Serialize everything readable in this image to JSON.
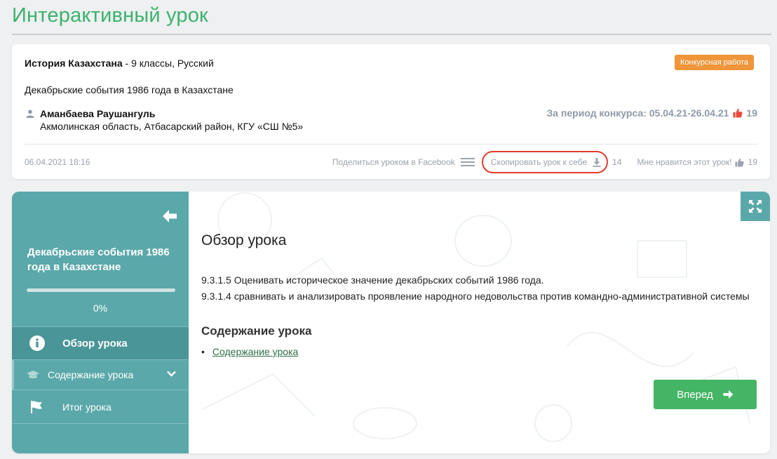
{
  "page": {
    "title": "Интерактивный урок"
  },
  "card": {
    "subject": "История Казахстана",
    "subject_sep": " - ",
    "subject_details": "9 классы, Русский",
    "badge": "Конкурсная работа",
    "lesson_title": "Декабрьские события 1986 года в Казахстане",
    "author_name": "Аманбаева Раушангуль",
    "author_place": "Акмолинская область, Атбасарский район, КГУ «СШ №5»",
    "period_label": "За период конкурса: 05.04.21-26.04.21",
    "period_likes": "19",
    "date": "06.04.2021 18:16",
    "share_label": "Поделиться уроком в Facebook",
    "copy_label": "Скопировать урок к себе",
    "copy_count": "14",
    "like_label": "Мне нравится этот урок!",
    "like_count": "19"
  },
  "sidebar": {
    "title": "Декабрьские события 1986 года в Казахстане",
    "progress_percent": 0,
    "progress_text": "0%",
    "items": [
      {
        "label": "Обзор урока",
        "icon": "info-icon",
        "active": true
      },
      {
        "label": "Содержание урока",
        "icon": "graduation-cap-icon",
        "expandable": true
      },
      {
        "label": "Итог урока",
        "icon": "flag-icon"
      }
    ]
  },
  "content": {
    "heading": "Обзор урока",
    "objectives": [
      "9.3.1.5 Оценивать историческое значение декабрьских событий 1986 года.",
      "9.3.1.4 сравнивать и анализировать проявление народного недовольства против командно-административной системы"
    ],
    "section_heading": "Содержание урока",
    "links": [
      "Содержание урока"
    ],
    "next_label": "Вперед"
  },
  "colors": {
    "title_green": "#3cb36b",
    "badge_orange": "#f0953a",
    "sidebar_teal": "#5ba8aa",
    "sidebar_active": "#4a9597",
    "button_green": "#44b564",
    "highlight_red": "#e53a2f",
    "link_green": "#2f6e49"
  }
}
